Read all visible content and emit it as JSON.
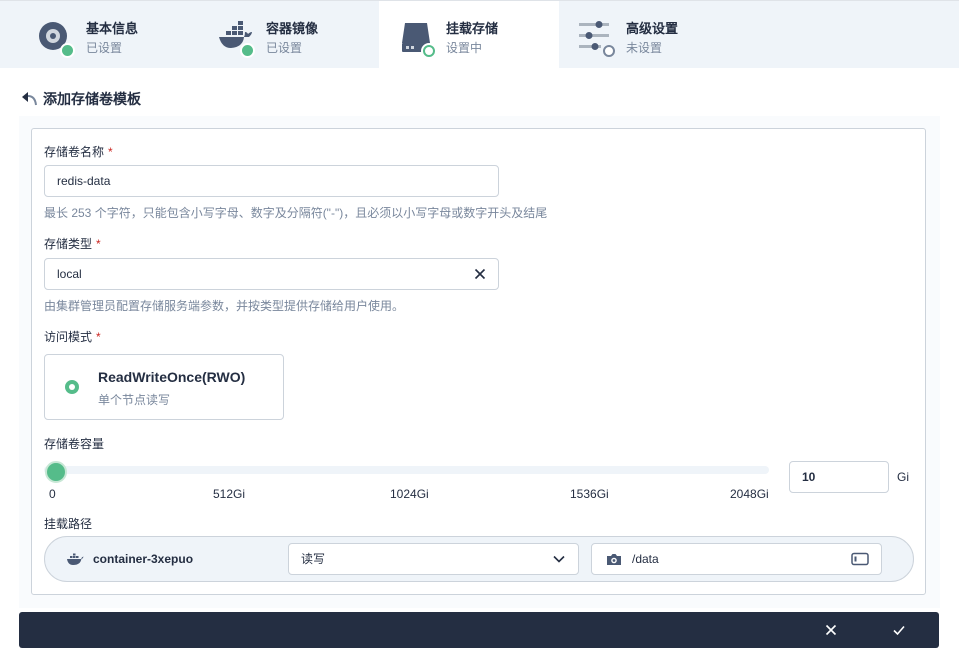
{
  "steps": [
    {
      "title": "基本信息",
      "status": "已设置",
      "state": "done",
      "icon": "info-disc-icon"
    },
    {
      "title": "容器镜像",
      "status": "已设置",
      "state": "done",
      "icon": "docker-whale-icon"
    },
    {
      "title": "挂载存储",
      "status": "设置中",
      "state": "doing",
      "icon": "storage-disk-icon"
    },
    {
      "title": "高级设置",
      "status": "未设置",
      "state": "todo",
      "icon": "sliders-icon"
    }
  ],
  "back": {
    "label": "添加存储卷模板",
    "icon": "back-arrow-icon"
  },
  "form": {
    "name": {
      "label": "存储卷名称",
      "required": "*",
      "value": "redis-data",
      "hint": "最长 253 个字符，只能包含小写字母、数字及分隔符(\"-\")，且必须以小写字母或数字开头及结尾"
    },
    "storage_class": {
      "label": "存储类型",
      "required": "*",
      "value": "local",
      "clear_icon": "close-icon",
      "hint": "由集群管理员配置存储服务端参数，并按类型提供存储给用户使用。"
    },
    "access_mode": {
      "label": "访问模式",
      "required": "*",
      "option_title": "ReadWriteOnce(RWO)",
      "option_desc": "单个节点读写",
      "selected": true
    },
    "capacity": {
      "label": "存储卷容量",
      "slider_value": 10,
      "slider_max": 2048,
      "ticks": [
        "0",
        "512Gi",
        "1024Gi",
        "1536Gi",
        "2048Gi"
      ],
      "input_value": "10",
      "unit": "Gi"
    },
    "mount": {
      "label": "挂载路径",
      "container_name": "container-3xepuo",
      "container_icon": "docker-whale-icon",
      "mode_value": "读写",
      "path_value": "/data",
      "path_icon": "mount-path-icon",
      "terminal_icon": "terminal-icon"
    }
  },
  "footer": {
    "cancel_icon": "close-icon",
    "confirm_icon": "check-icon"
  },
  "colors": {
    "accent": "#55bc8a",
    "text": "#242e42",
    "muted": "#79879c",
    "footer_bg": "#242e42",
    "required": "#ca2621"
  }
}
